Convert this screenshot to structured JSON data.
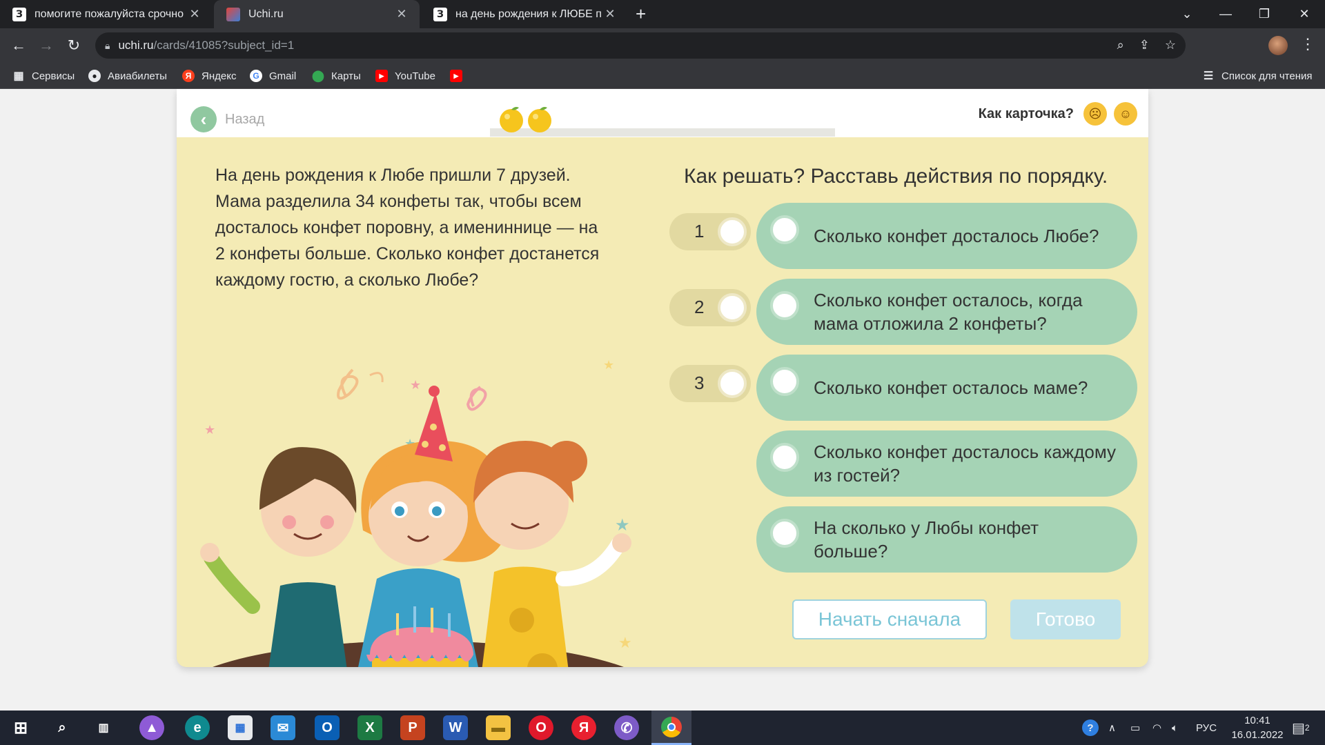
{
  "browser": {
    "tabs": [
      {
        "title": "помогите пожалуйста срочно -",
        "favicon": "З",
        "active": false
      },
      {
        "title": "Uchi.ru",
        "favicon": "uchi",
        "active": true
      },
      {
        "title": "на день рождения к ЛЮБЕ при",
        "favicon": "З",
        "active": false
      }
    ],
    "url_host": "uchi.ru",
    "url_path": "/cards/41085?subject_id=1",
    "bookmarks": [
      "Сервисы",
      "Авиабилеты",
      "Яндекс",
      "Gmail",
      "Карты",
      "YouTube"
    ],
    "reading_list": "Список для чтения"
  },
  "card": {
    "back_label": "Назад",
    "rating_question": "Как карточка?",
    "problem_text": "На день рождения к Любе пришли 7 друзей. Мама разделила 34 конфеты так, чтобы всем досталось конфет поровну, а имениннице — на 2 конфеты больше. Сколько конфет достанется каждому гостю, а сколько Любе?",
    "instruction": "Как решать? Расставь действия по порядку.",
    "slots": [
      "1",
      "2",
      "3"
    ],
    "options": [
      "Сколько конфет досталось Любе?",
      "Сколько конфет осталось, когда мама отложила 2 конфеты?",
      "Сколько конфет осталось маме?",
      "Сколько конфет досталось каждому из гостей?",
      "На сколько у Любы конфет больше?"
    ],
    "restart_label": "Начать сначала",
    "done_label": "Готово"
  },
  "taskbar": {
    "lang": "РУС",
    "time": "10:41",
    "date": "16.01.2022",
    "notifications": "2"
  },
  "colors": {
    "card_bg": "#f4ebb5",
    "option_bg": "#a5d3b5",
    "slot_bg": "#e2d9a1",
    "button_outline": "#9fd3de"
  }
}
